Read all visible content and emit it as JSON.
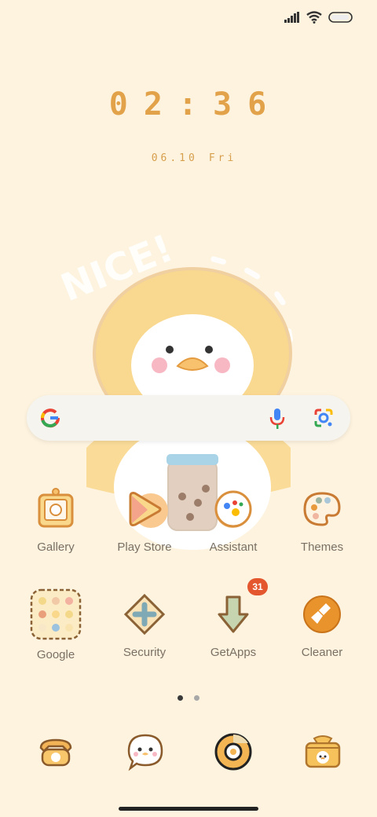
{
  "status": {
    "icons": [
      "signal-icon",
      "wifi-icon",
      "battery-icon"
    ]
  },
  "lockscreen": {
    "time": "02:36",
    "date": "06.10",
    "weekday": "Fri"
  },
  "wallpaper": {
    "text": "NICE!"
  },
  "search": {
    "icons": [
      "google-logo-icon",
      "microphone-icon",
      "lens-icon"
    ]
  },
  "apps": [
    {
      "label": "Gallery",
      "icon": "gallery-icon"
    },
    {
      "label": "Play Store",
      "icon": "play-store-icon"
    },
    {
      "label": "Assistant",
      "icon": "assistant-icon"
    },
    {
      "label": "Themes",
      "icon": "themes-icon"
    },
    {
      "label": "Google",
      "icon": "google-folder-icon"
    },
    {
      "label": "Security",
      "icon": "security-icon"
    },
    {
      "label": "GetApps",
      "icon": "getapps-icon",
      "badge": "31"
    },
    {
      "label": "Cleaner",
      "icon": "cleaner-icon"
    }
  ],
  "pages": {
    "count": 2,
    "current": 1
  },
  "dock": [
    "phone-icon",
    "messages-icon",
    "chrome-icon",
    "camera-icon"
  ],
  "colors": {
    "background": "#FDF3DF",
    "accent": "#E2A24A",
    "badge": "#E4572E",
    "label": "#7A7064"
  }
}
